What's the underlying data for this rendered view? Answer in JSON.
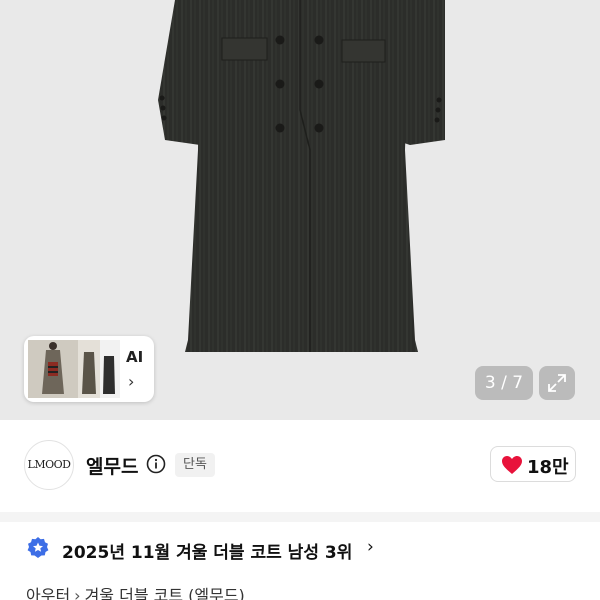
{
  "gallery": {
    "pager_text": "3 / 7",
    "ai_label": "AI",
    "ai_chevron": "›",
    "expand_icon": "expand-icon"
  },
  "brand": {
    "logo_text": "LMOOD",
    "name": "엘무드",
    "badge": "단독",
    "like_count": "18만",
    "heart_color": "#e8123b"
  },
  "ranking": {
    "text": "2025년 11월 겨울 더블 코트 남성 3위",
    "chevron": "›",
    "badge_color": "#3d6ee6"
  },
  "breadcrumb": {
    "items": [
      "아우터",
      "겨울 더블 코트 (엘무드)"
    ],
    "separator": "›"
  }
}
